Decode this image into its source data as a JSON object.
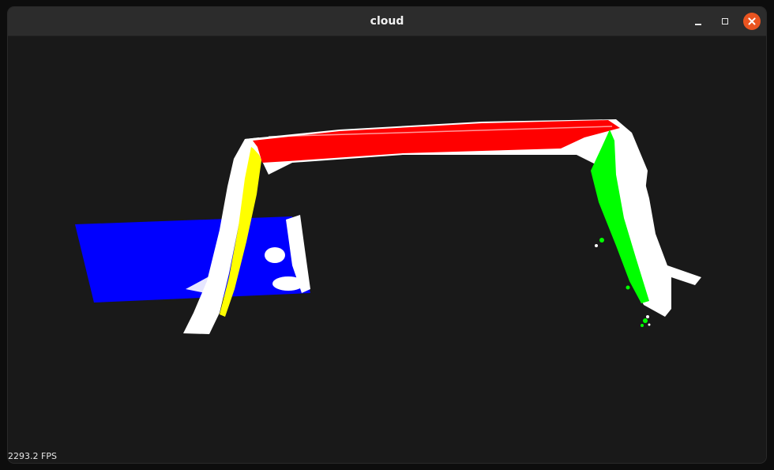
{
  "window": {
    "title": "cloud"
  },
  "viewer": {
    "fps_text": "2293.2 FPS",
    "background_color": "#1a1a1a",
    "segment_colors": {
      "plane": "#0000ff",
      "left_leg": "#ffff00",
      "top_bar": "#ff0000",
      "right_leg": "#00ff00",
      "unlabeled": "#ffffff"
    }
  },
  "icons": {
    "minimize": "minimize-icon",
    "maximize": "maximize-icon",
    "close": "close-icon"
  }
}
